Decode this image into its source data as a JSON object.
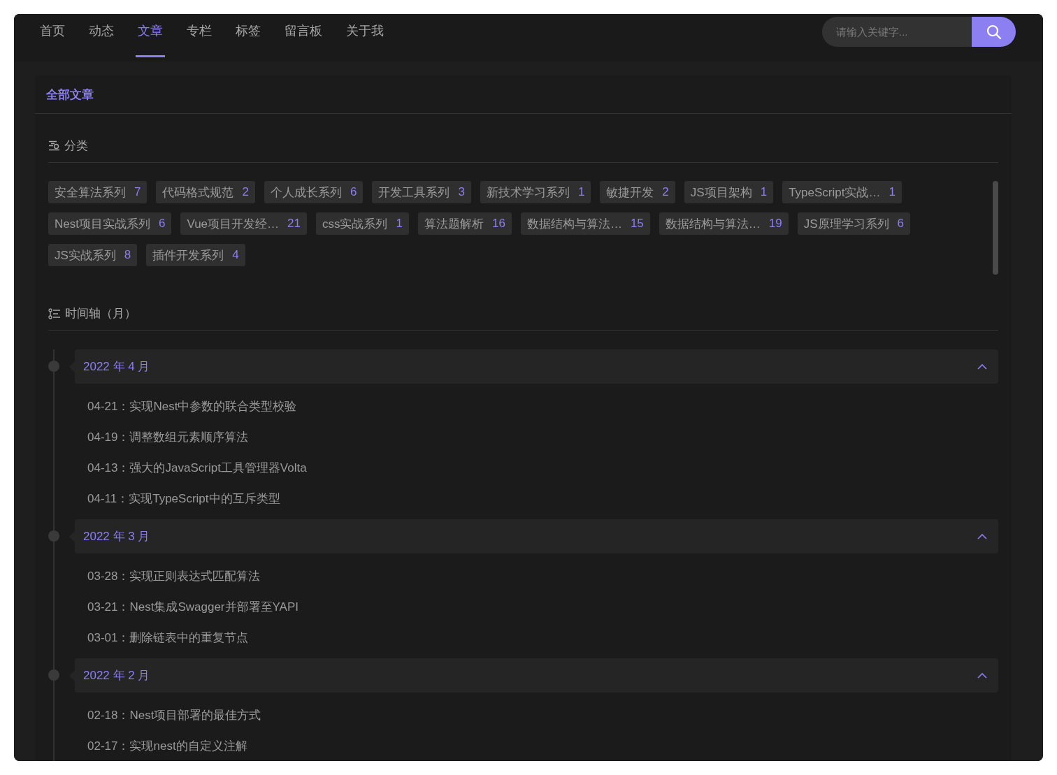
{
  "nav": {
    "items": [
      {
        "label": "首页",
        "selected": false
      },
      {
        "label": "动态",
        "selected": false
      },
      {
        "label": "文章",
        "selected": true
      },
      {
        "label": "专栏",
        "selected": false
      },
      {
        "label": "标签",
        "selected": false
      },
      {
        "label": "留言板",
        "selected": false
      },
      {
        "label": "关于我",
        "selected": false
      }
    ],
    "search": {
      "placeholder": "请输入关键字..."
    }
  },
  "card": {
    "title": "全部文章",
    "categories": {
      "heading": "分类",
      "tags": [
        {
          "name": "安全算法系列",
          "count": "7"
        },
        {
          "name": "代码格式规范",
          "count": "2"
        },
        {
          "name": "个人成长系列",
          "count": "6"
        },
        {
          "name": "开发工具系列",
          "count": "3"
        },
        {
          "name": "新技术学习系列",
          "count": "1"
        },
        {
          "name": "敏捷开发",
          "count": "2"
        },
        {
          "name": "JS项目架构",
          "count": "1"
        },
        {
          "name": "TypeScript实战…",
          "count": "1"
        },
        {
          "name": "Nest项目实战系列",
          "count": "6"
        },
        {
          "name": "Vue项目开发经…",
          "count": "21"
        },
        {
          "name": "css实战系列",
          "count": "1"
        },
        {
          "name": "算法题解析",
          "count": "16"
        },
        {
          "name": "数据结构与算法…",
          "count": "15"
        },
        {
          "name": "数据结构与算法…",
          "count": "19"
        },
        {
          "name": "JS原理学习系列",
          "count": "6"
        },
        {
          "name": "JS实战系列",
          "count": "8"
        },
        {
          "name": "插件开发系列",
          "count": "4"
        }
      ]
    },
    "timeline": {
      "heading": "时间轴（月）",
      "groups": [
        {
          "month": "2022 年 4 月",
          "expanded": true,
          "posts": [
            {
              "date": "04-21：",
              "title": "实现Nest中参数的联合类型校验"
            },
            {
              "date": "04-19：",
              "title": "调整数组元素顺序算法"
            },
            {
              "date": "04-13：",
              "title": "强大的JavaScript工具管理器Volta"
            },
            {
              "date": "04-11：",
              "title": "实现TypeScript中的互斥类型"
            }
          ]
        },
        {
          "month": "2022 年 3 月",
          "expanded": true,
          "posts": [
            {
              "date": "03-28：",
              "title": "实现正则表达式匹配算法"
            },
            {
              "date": "03-21：",
              "title": "Nest集成Swagger并部署至YAPI"
            },
            {
              "date": "03-01：",
              "title": "删除链表中的重复节点"
            }
          ]
        },
        {
          "month": "2022 年 2 月",
          "expanded": true,
          "posts": [
            {
              "date": "02-18：",
              "title": "Nest项目部署的最佳方式"
            },
            {
              "date": "02-17：",
              "title": "实现nest的自定义注解"
            }
          ]
        }
      ]
    }
  }
}
